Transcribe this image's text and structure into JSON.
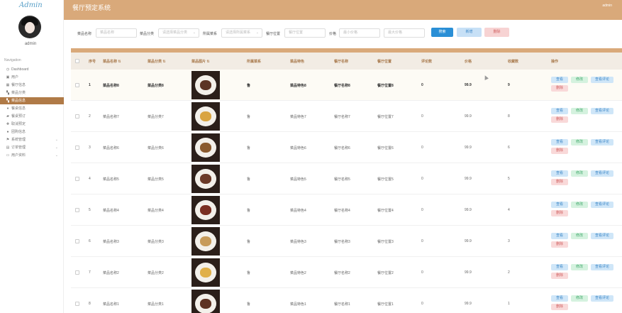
{
  "brand": {
    "logo_text": "Admin"
  },
  "app": {
    "title": "餐厅预定系统",
    "user": "admin"
  },
  "sidebar": {
    "username": "admin",
    "heading": "Navigation",
    "items": [
      {
        "label": "Dashboard",
        "icon": "dashboard-icon",
        "glyph": "◷"
      },
      {
        "label": "用户",
        "icon": "user-icon",
        "glyph": "▣"
      },
      {
        "label": "餐厅信息",
        "icon": "store-icon",
        "glyph": "▦"
      },
      {
        "label": "菜品分类",
        "icon": "category-icon",
        "glyph": "▚"
      },
      {
        "label": "菜品信息",
        "icon": "dish-icon",
        "glyph": "▚",
        "active": true
      },
      {
        "label": "餐桌信息",
        "icon": "table-icon",
        "glyph": "♦"
      },
      {
        "label": "餐桌预订",
        "icon": "booking-icon",
        "glyph": "▰"
      },
      {
        "label": "取消预定",
        "icon": "cancel-icon",
        "glyph": "✚"
      },
      {
        "label": "团购信息",
        "icon": "group-icon",
        "glyph": "●"
      },
      {
        "label": "系统管理",
        "icon": "flag-icon",
        "glyph": "⚑",
        "caret": "⌄"
      },
      {
        "label": "订单管理",
        "icon": "order-icon",
        "glyph": "▤",
        "caret": "⌄"
      },
      {
        "label": "用户资料",
        "icon": "profile-icon",
        "glyph": "▭",
        "caret": "⌄"
      }
    ]
  },
  "search": {
    "dish_name_label": "菜品名称",
    "dish_name_placeholder": "菜品名称",
    "category_label": "菜品分类",
    "category_placeholder": "请选择菜品分类",
    "restaurant_label": "所属菜系",
    "restaurant_placeholder": "请选择所属菜系",
    "location_label": "餐厅位置",
    "location_placeholder": "餐厅位置",
    "price_label": "价格",
    "price_min_placeholder": "最小价格",
    "price_max_placeholder": "最大价格",
    "search_button": "搜索",
    "add_button": "新增",
    "delete_button": "删除"
  },
  "table": {
    "columns": [
      "序号",
      "菜品名称 ⇅",
      "菜品分类 ⇅",
      "菜品图片 ⇅",
      "所属菜系",
      "菜品特色",
      "餐厅名称",
      "餐厅位置",
      "评论数",
      "价格",
      "收藏数",
      "操作"
    ],
    "actions": {
      "view": "查看",
      "edit": "修改",
      "comment": "查看评论",
      "delete": "删除"
    },
    "rows": [
      {
        "no": "1",
        "name": "菜品名称8",
        "category": "菜品分类8",
        "cuisine": "鲁",
        "feature": "菜品特色8",
        "restaurant": "餐厅名称8",
        "location": "餐厅位置8",
        "comments": "0",
        "price": "99.9",
        "favorites": "9",
        "food_color": "#5b3425"
      },
      {
        "no": "2",
        "name": "菜品名称7",
        "category": "菜品分类7",
        "cuisine": "鲁",
        "feature": "菜品特色7",
        "restaurant": "餐厅名称7",
        "location": "餐厅位置7",
        "comments": "0",
        "price": "99.9",
        "favorites": "8",
        "food_color": "#d9a441"
      },
      {
        "no": "3",
        "name": "菜品名称6",
        "category": "菜品分类6",
        "cuisine": "鲁",
        "feature": "菜品特色6",
        "restaurant": "餐厅名称6",
        "location": "餐厅位置6",
        "comments": "0",
        "price": "99.9",
        "favorites": "6",
        "food_color": "#8a5a2e"
      },
      {
        "no": "4",
        "name": "菜品名称5",
        "category": "菜品分类5",
        "cuisine": "鲁",
        "feature": "菜品特色5",
        "restaurant": "餐厅名称5",
        "location": "餐厅位置5",
        "comments": "0",
        "price": "99.9",
        "favorites": "5",
        "food_color": "#6b3a28"
      },
      {
        "no": "5",
        "name": "菜品名称4",
        "category": "菜品分类4",
        "cuisine": "鲁",
        "feature": "菜品特色4",
        "restaurant": "餐厅名称4",
        "location": "餐厅位置4",
        "comments": "0",
        "price": "99.9",
        "favorites": "4",
        "food_color": "#7a2f22"
      },
      {
        "no": "6",
        "name": "菜品名称3",
        "category": "菜品分类3",
        "cuisine": "鲁",
        "feature": "菜品特色3",
        "restaurant": "餐厅名称3",
        "location": "餐厅位置3",
        "comments": "0",
        "price": "99.9",
        "favorites": "3",
        "food_color": "#c79b5a"
      },
      {
        "no": "7",
        "name": "菜品名称2",
        "category": "菜品分类2",
        "cuisine": "鲁",
        "feature": "菜品特色2",
        "restaurant": "餐厅名称2",
        "location": "餐厅位置2",
        "comments": "0",
        "price": "99.9",
        "favorites": "2",
        "food_color": "#e0b04a"
      },
      {
        "no": "8",
        "name": "菜品名称1",
        "category": "菜品分类1",
        "cuisine": "鲁",
        "feature": "菜品特色1",
        "restaurant": "餐厅名称1",
        "location": "餐厅位置1",
        "comments": "0",
        "price": "99.9",
        "favorites": "1",
        "food_color": "#5e3323"
      }
    ]
  },
  "colors": {
    "header": "#d9a97a",
    "sidebar_active": "#b07a47",
    "primary": "#2a8fd6"
  }
}
